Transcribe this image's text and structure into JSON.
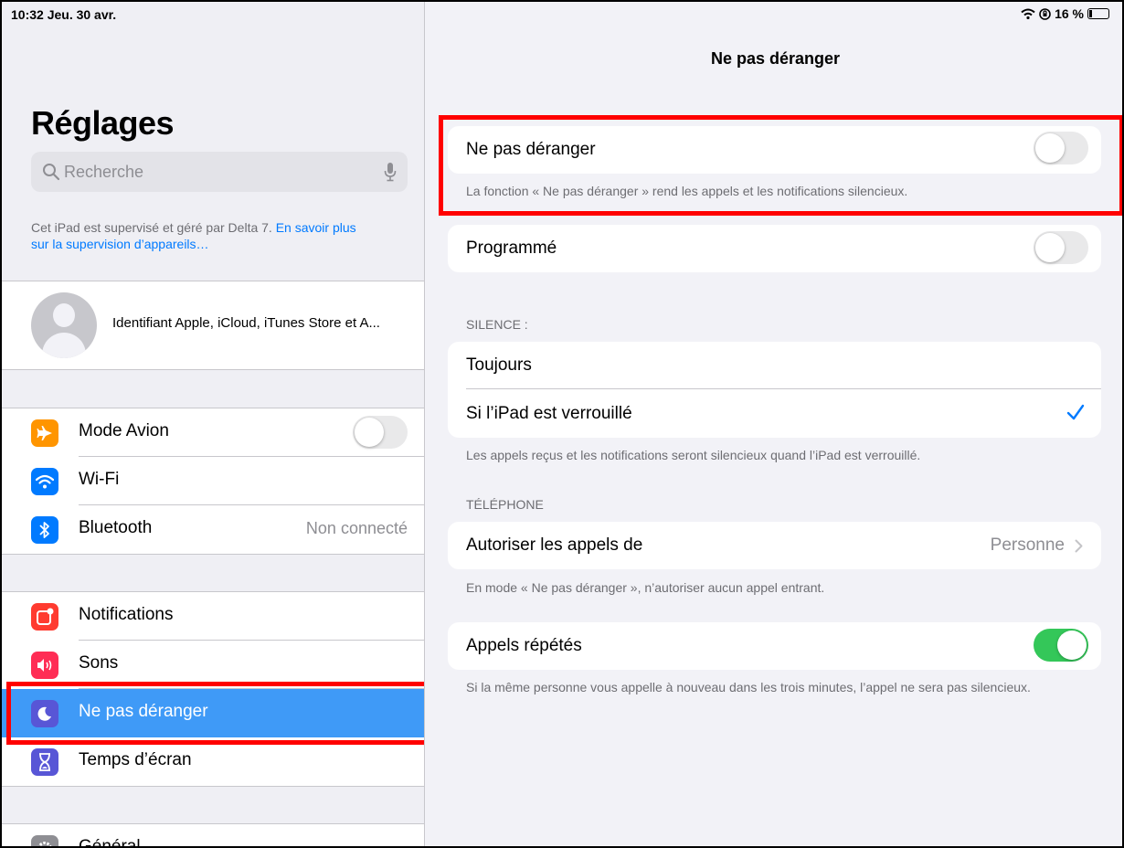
{
  "status_bar": {
    "time": "10:32  Jeu. 30 avr.",
    "battery": "16 %"
  },
  "sidebar": {
    "title": "Réglages",
    "search_placeholder": "Recherche",
    "supervision_text": "Cet iPad est supervisé et géré par Delta 7. ",
    "supervision_link_1": "En savoir plus",
    "supervision_link_2": "sur la supervision d’appareils…",
    "account_label": "Identifiant Apple, iCloud, iTunes Store et A...",
    "group1": [
      {
        "label": "Mode Avion",
        "icon": "airplane-icon",
        "color": "#ff9500",
        "toggle": false
      },
      {
        "label": "Wi-Fi",
        "icon": "wifi-icon",
        "color": "#007aff"
      },
      {
        "label": "Bluetooth",
        "icon": "bluetooth-icon",
        "color": "#007aff",
        "value": "Non connecté"
      }
    ],
    "group2": [
      {
        "label": "Notifications",
        "icon": "notifications-icon",
        "color": "#ff3b30"
      },
      {
        "label": "Sons",
        "icon": "sound-icon",
        "color": "#ff2d55"
      },
      {
        "label": "Ne pas déranger",
        "icon": "moon-icon",
        "color": "#5856d6",
        "selected": true
      },
      {
        "label": "Temps d’écran",
        "icon": "hourglass-icon",
        "color": "#5856d6"
      }
    ],
    "group3": [
      {
        "label": "Général",
        "icon": "gear-icon",
        "color": "#8e8e93"
      }
    ]
  },
  "detail": {
    "nav_title": "Ne pas déranger",
    "dnd_label": "Ne pas déranger",
    "dnd_toggle": false,
    "dnd_note": "La fonction « Ne pas déranger » rend les appels et les notifications silencieux.",
    "scheduled_label": "Programmé",
    "scheduled_toggle": false,
    "silence_header": "SILENCE :",
    "silence_always": "Toujours",
    "silence_locked": "Si l’iPad est verrouillé",
    "silence_note": "Les appels reçus et les notifications seront silencieux quand l’iPad est verrouillé.",
    "phone_header": "TÉLÉPHONE",
    "allow_calls_label": "Autoriser les appels de",
    "allow_calls_value": "Personne",
    "allow_calls_note": "En mode « Ne pas déranger », n’autoriser aucun appel entrant.",
    "repeated_label": "Appels répétés",
    "repeated_toggle": true,
    "repeated_note": "Si la même personne vous appelle à nouveau dans les trois minutes, l’appel ne sera pas silencieux."
  },
  "colors": {
    "accent": "#007aff",
    "highlight": "#ff0000",
    "selected_row": "#3f9af7",
    "switch_on": "#34c759"
  }
}
